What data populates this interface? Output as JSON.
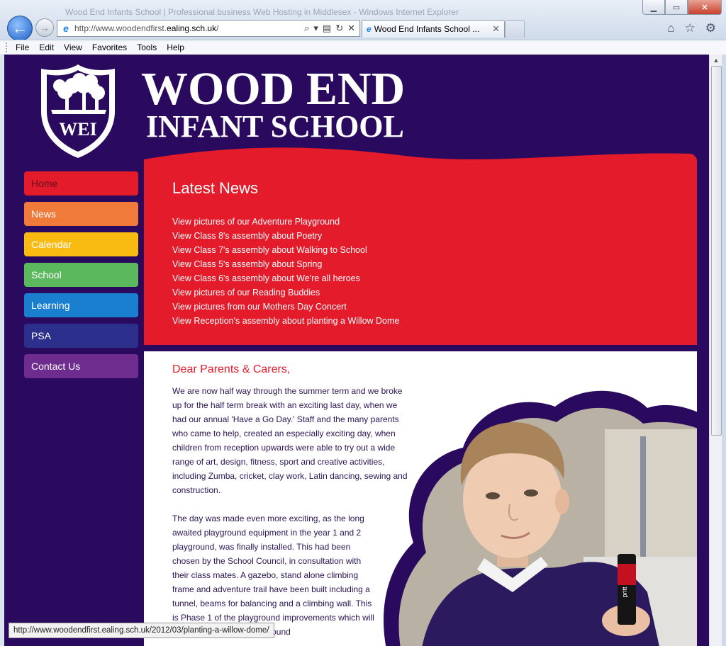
{
  "browser": {
    "ghost_title": "Wood End Infants School | Professional business Web Hosting in Middlesex - Windows Internet Explorer",
    "url_prefix": "http://www.woodendfirst.",
    "url_domain": "ealing.sch.uk",
    "url_suffix": "/",
    "tab_title": "Wood End Infants School ...",
    "menu": [
      "File",
      "Edit",
      "View",
      "Favorites",
      "Tools",
      "Help"
    ],
    "status_text": "http://www.woodendfirst.ealing.sch.uk/2012/03/planting-a-willow-dome/",
    "icons": [
      "back-icon",
      "forward-icon",
      "search-icon",
      "home-icon",
      "favorites-star-icon",
      "gear-icon"
    ]
  },
  "site": {
    "crest_letters": "WEI",
    "title_line1": "WOOD END",
    "title_line2": "INFANT SCHOOL",
    "colors": {
      "background": "#2a0a5e",
      "news_red": "#e31b2a"
    }
  },
  "nav": [
    {
      "label": "Home",
      "color": "#e31b2a"
    },
    {
      "label": "News",
      "color": "#f07a3a"
    },
    {
      "label": "Calendar",
      "color": "#f9bb12"
    },
    {
      "label": "School",
      "color": "#5cb85c"
    },
    {
      "label": "Learning",
      "color": "#1a7fcf"
    },
    {
      "label": "PSA",
      "color": "#2d2f8c"
    },
    {
      "label": "Contact Us",
      "color": "#6e2c8f"
    }
  ],
  "news": {
    "title": "Latest News",
    "items": [
      "View pictures of our Adventure Playground",
      "View Class 8's assembly about Poetry",
      "View Class 7's assembly about Walking to School",
      "View Class 5's assembly about Spring",
      "View Class 6's assembly about We're all heroes",
      "View pictures of our Reading Buddies",
      "View pictures from our Mothers Day Concert",
      "View Reception's assembly about planting a Willow Dome"
    ]
  },
  "content": {
    "greeting": "Dear Parents & Carers,",
    "paragraph1": "We are now half way through the summer term and we broke up for the half term break with an exciting last day, when we had our annual 'Have a Go Day.' Staff and the many parents who came to help, created an especially exciting day, when children from reception upwards were able to try out a wide range of art, design, fitness, sport and creative activities, including Zumba, cricket, clay work, Latin dancing, sewing and construction.",
    "paragraph2": "The day was made even more exciting, as the long awaited playground equipment in the year 1 and 2 playground, was finally installed. This had been chosen by the School Council, in consultation with their class mates. A gazebo, stand alone climbing frame and adventure trail have been built including a tunnel, beams for balancing and a climbing wall. This is Phase 1 of the playground improvements which will include a change of playground",
    "photo_glue_label": "pritt"
  }
}
